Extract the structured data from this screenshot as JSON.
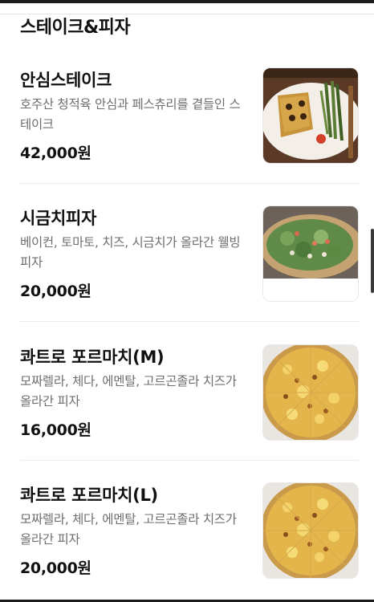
{
  "section": {
    "title": "스테이크&피자"
  },
  "menu": {
    "items": [
      {
        "name": "안심스테이크",
        "desc": "호주산 청적육 안심과 페스츄리를 곁들인 스테이크",
        "price": "42,000원",
        "image": "steak-photo"
      },
      {
        "name": "시금치피자",
        "desc": "베이컨, 토마토, 치즈, 시금치가 올라간 웰빙 피자",
        "price": "20,000원",
        "image": "spinach-pizza-photo"
      },
      {
        "name": "콰트로 포르마치(M)",
        "desc": "모짜렐라, 체다, 에멘탈, 고르곤졸라 치즈가 올라간 피자",
        "price": "16,000원",
        "image": "quattro-pizza-photo"
      },
      {
        "name": "콰트로 포르마치(L)",
        "desc": "모짜렐라, 체다, 에멘탈, 고르곤졸라 치즈가 올라간 피자",
        "price": "20,000원",
        "image": "quattro-pizza-photo"
      }
    ]
  }
}
